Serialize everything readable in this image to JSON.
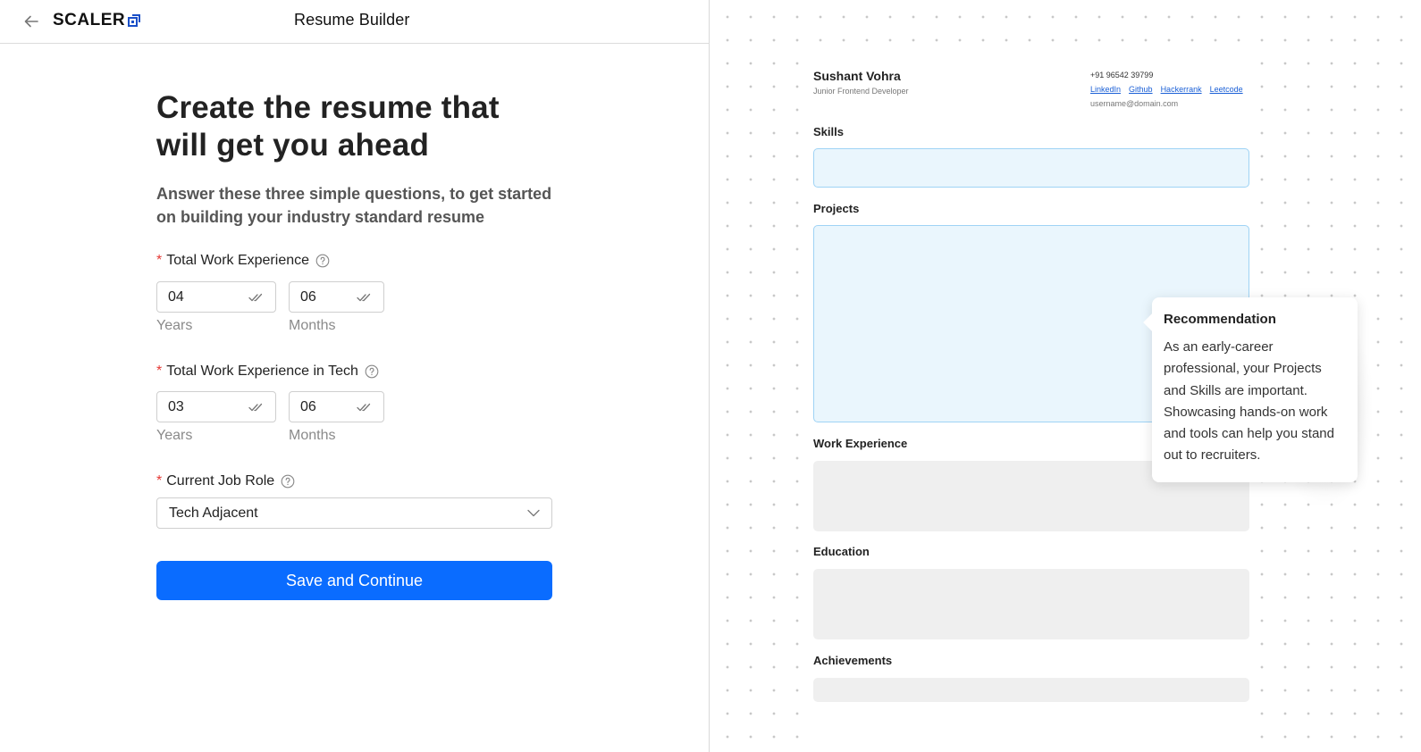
{
  "header": {
    "logo_text": "SCALER",
    "title": "Resume Builder"
  },
  "form": {
    "headline": "Create the resume that will get you ahead",
    "subtitle": "Answer these three simple questions, to get started on building your industry standard resume",
    "required_mark": "*",
    "work_experience": {
      "label": "Total Work Experience",
      "years_value": "04",
      "years_label": "Years",
      "months_value": "06",
      "months_label": "Months"
    },
    "tech_experience": {
      "label": "Total Work Experience in Tech",
      "years_value": "03",
      "years_label": "Years",
      "months_value": "06",
      "months_label": "Months"
    },
    "job_role": {
      "label": "Current Job Role",
      "selected": "Tech Adjacent"
    },
    "submit_label": "Save and Continue"
  },
  "resume_preview": {
    "name": "Sushant Vohra",
    "role": "Junior Frontend Developer",
    "phone": "+91 96542 39799",
    "links": [
      "LinkedIn",
      "Github",
      "Hackerrank",
      "Leetcode"
    ],
    "email": "username@domain.com",
    "sections": {
      "skills": "Skills",
      "projects": "Projects",
      "work_experience": "Work Experience",
      "education": "Education",
      "achievements": "Achievements"
    }
  },
  "recommendation": {
    "title": "Recommendation",
    "body": "As an early-career professional, your Projects and Skills are important. Showcasing hands-on work and tools can help you stand out to recruiters."
  },
  "colors": {
    "primary": "#0a6cff",
    "required": "#e53935",
    "highlight_fill": "#eaf6fd",
    "highlight_border": "#9fd3f5",
    "placeholder_fill": "#efefef"
  }
}
